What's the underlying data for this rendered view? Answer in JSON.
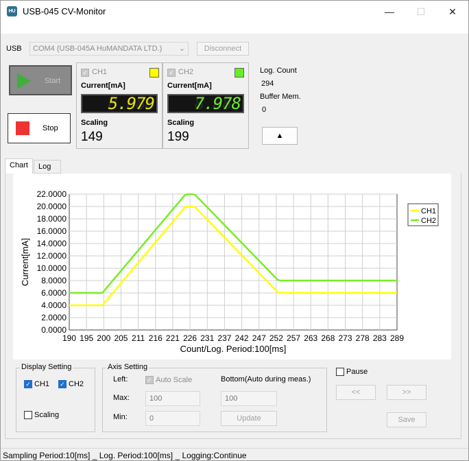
{
  "window": {
    "title": "USB-045 CV-Monitor",
    "icon_label": "HU",
    "minimize": "—",
    "maximize": "☐",
    "close": "✕"
  },
  "usb": {
    "label": "USB",
    "port": "COM4 (USB-045A HuMANDATA LTD.)",
    "disconnect": "Disconnect"
  },
  "controls": {
    "start": "Start",
    "stop": "Stop"
  },
  "channels": [
    {
      "name": "CH1",
      "current_label": "Current[mA]",
      "current": "5.979",
      "scaling_label": "Scaling",
      "scaling": "149",
      "color": "#ffff00",
      "lcd_color": "#e6e600"
    },
    {
      "name": "CH2",
      "current_label": "Current[mA]",
      "current": "7.978",
      "scaling_label": "Scaling",
      "scaling": "199",
      "color": "#66ee22",
      "lcd_color": "#66ee22"
    }
  ],
  "log": {
    "count_label": "Log. Count",
    "count": "294",
    "buffer_label": "Buffer Mem.",
    "buffer": "0",
    "up_button": "▲"
  },
  "tabs": [
    {
      "label": "Chart"
    },
    {
      "label": "Log"
    }
  ],
  "chart_data": {
    "type": "line",
    "xlabel": "Count/Log. Period:100[ms]",
    "ylabel": "Current[mA]",
    "xlim": [
      190,
      289
    ],
    "ylim": [
      0,
      22
    ],
    "x_ticks": [
      "190",
      "195",
      "200",
      "205",
      "211",
      "216",
      "221",
      "226",
      "231",
      "237",
      "242",
      "247",
      "252",
      "257",
      "263",
      "268",
      "273",
      "278",
      "283",
      "289"
    ],
    "y_ticks": [
      "0.0000",
      "2.0000",
      "4.0000",
      "6.0000",
      "8.0000",
      "10.0000",
      "12.0000",
      "14.0000",
      "16.0000",
      "18.0000",
      "20.0000",
      "22.0000"
    ],
    "grid": true,
    "legend": "top-right",
    "series": [
      {
        "name": "CH1",
        "color": "#ffff00",
        "x": [
          190,
          198,
          200,
          225,
          226,
          227,
          228,
          253,
          255,
          289
        ],
        "values": [
          4.0,
          4.0,
          4.0,
          19.9,
          20.0,
          20.0,
          19.9,
          6.1,
          6.0,
          6.0
        ]
      },
      {
        "name": "CH2",
        "color": "#77ee22",
        "x": [
          190,
          198,
          200,
          225,
          226,
          227,
          228,
          253,
          254,
          289
        ],
        "values": [
          6.0,
          6.0,
          6.0,
          21.9,
          22.0,
          22.0,
          21.9,
          8.1,
          8.0,
          8.0
        ]
      }
    ]
  },
  "display_setting": {
    "title": "Display Setting",
    "ch1": "CH1",
    "ch2": "CH2",
    "scaling": "Scaling"
  },
  "axis_setting": {
    "title": "Axis Setting",
    "left_label": "Left:",
    "auto_scale": "Auto Scale",
    "bottom_label": "Bottom(Auto during meas.)",
    "max_label": "Max:",
    "max_value": "100",
    "min_label": "Min:",
    "min_value": "0",
    "bottom_value": "100",
    "update": "Update"
  },
  "nav": {
    "pause": "Pause",
    "prev": "<<",
    "next": ">>",
    "save": "Save"
  },
  "status": "Sampling Period:10[ms] _ Log. Period:100[ms] _ Logging:Continue"
}
